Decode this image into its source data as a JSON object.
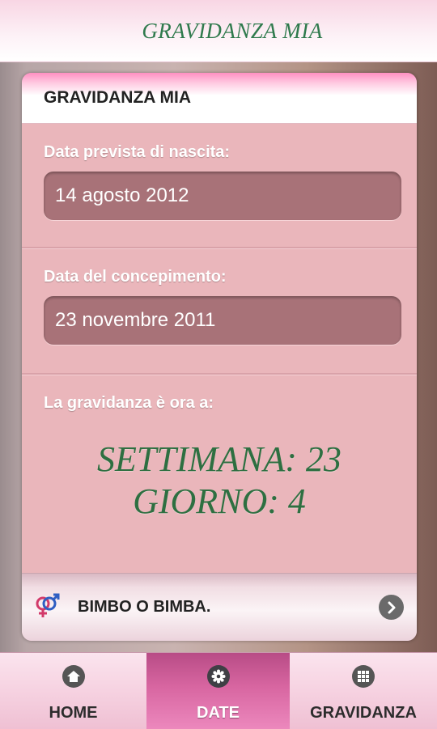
{
  "app": {
    "title": "GRAVIDANZA MIA"
  },
  "card": {
    "title": "GRAVIDANZA MIA",
    "due_date": {
      "label": "Data prevista di nascita:",
      "value": "14 agosto 2012"
    },
    "conception": {
      "label": "Data del concepimento:",
      "value": "23 novembre 2011"
    },
    "status": {
      "label": "La gravidanza è ora a:",
      "week_line": "SETTIMANA: 23",
      "day_line": "GIORNO: 4"
    },
    "promo": {
      "label": "BIMBO O BIMBA.",
      "icon": "gender-symbols-icon"
    }
  },
  "tabs": [
    {
      "label": "HOME",
      "icon": "home-icon",
      "active": false
    },
    {
      "label": "DATE",
      "icon": "gear-icon",
      "active": true
    },
    {
      "label": "GRAVIDANZA",
      "icon": "grid-icon",
      "active": false
    }
  ],
  "colors": {
    "accent_green": "#2e6f41",
    "card_pink": "#eab6bb",
    "field_mauve": "#a87278",
    "active_tab": "#d866a1"
  }
}
